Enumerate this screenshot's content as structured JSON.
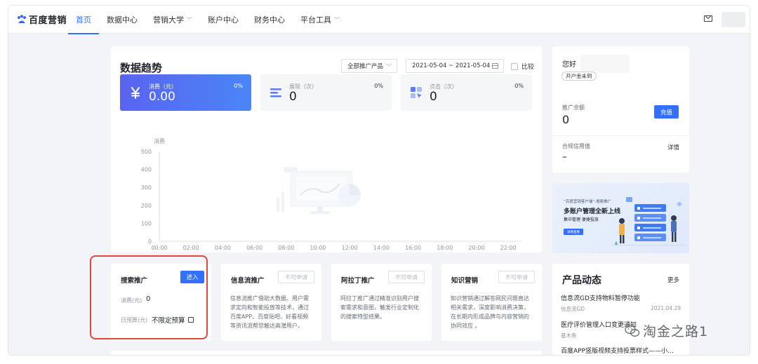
{
  "nav": {
    "logo": "百度营销",
    "items": [
      {
        "label": "首页",
        "active": true,
        "dropdown": false
      },
      {
        "label": "数据中心",
        "active": false,
        "dropdown": false
      },
      {
        "label": "营销大学",
        "active": false,
        "dropdown": true
      },
      {
        "label": "账户中心",
        "active": false,
        "dropdown": false
      },
      {
        "label": "财务中心",
        "active": false,
        "dropdown": false
      },
      {
        "label": "平台工具",
        "active": false,
        "dropdown": true
      }
    ],
    "icons": [
      "mail-icon",
      "avatar"
    ]
  },
  "trend": {
    "title": "数据趋势",
    "product_select": "全部推广产品",
    "date_range": "2021-05-04 ~ 2021-05-04",
    "compare_label": "比较",
    "metrics": [
      {
        "label": "消费（元）",
        "value": "0.00",
        "pct": "0%",
        "icon": "yuan-icon"
      },
      {
        "label": "展现（次）",
        "value": "0",
        "pct": "0%",
        "icon": "list-icon"
      },
      {
        "label": "点击（次）",
        "value": "0",
        "pct": "0%",
        "icon": "click-icon"
      }
    ]
  },
  "chart_data": {
    "type": "line",
    "ylabel": "消费",
    "ylim": [
      0,
      500
    ],
    "yticks": [
      0,
      100,
      200,
      300,
      400,
      500
    ],
    "categories": [
      "00:00",
      "02:00",
      "04:00",
      "06:00",
      "08:00",
      "10:00",
      "12:00",
      "14:00",
      "16:00",
      "18:00",
      "20:00",
      "22:00"
    ],
    "series": [],
    "empty_state": true
  },
  "account": {
    "greeting": "您好",
    "badge": "开户金未到",
    "balance_label": "推广余额",
    "balance_value": "0",
    "recharge_label": "充值",
    "credit_label": "合规信用值",
    "credit_detail": "详情",
    "credit_value": "–"
  },
  "banner": {
    "tag": "“百度营销客户端”-搜索推广",
    "title": "多账户管理全新上线",
    "sub": "集中管理  便捷投放",
    "button": "详情查看"
  },
  "services": [
    {
      "title": "搜索推广",
      "button": "进入",
      "spend_label": "消费(元)",
      "spend_value": "0",
      "budget_label": "日预算(元)",
      "budget_value": "不限定预算"
    },
    {
      "title": "信息流推广",
      "button": "不可申请",
      "desc": "信息流推广借助大数据、用户需求定向和智能投放等技术，通过百度APP、百度贴吧、好看视频等资讯流帮您触达高潜用户。"
    },
    {
      "title": "阿拉丁推广",
      "button": "不可申请",
      "desc": "阿拉丁推广通过精准识别用户搜索需求和意图，触发行业定制化的搜索特型结果。"
    },
    {
      "title": "知识营销",
      "button": "不可申请",
      "desc": "知识营销通过解答网民问题直达相关需求，深度影响消费决策，在长期内形成品牌与内容营销的协同效应 。"
    }
  ],
  "news": {
    "title": "产品动态",
    "more": "更多",
    "items": [
      {
        "title": "信息流GD支持物料暂停功能",
        "source": "信息流GD",
        "date": "2021.04.29"
      },
      {
        "title": "医疗评价管理入口变更通知",
        "source": "基木鱼",
        "date": ""
      },
      {
        "title": "百度APP竖版视频支持投票样式——小…",
        "source": "",
        "date": ""
      }
    ]
  },
  "watermark": "淘金之路1",
  "colors": {
    "accent": "#3370ff",
    "highlight": "#e0463b",
    "primary_gradient_start": "#5a63f0",
    "primary_gradient_end": "#4a86f7"
  }
}
